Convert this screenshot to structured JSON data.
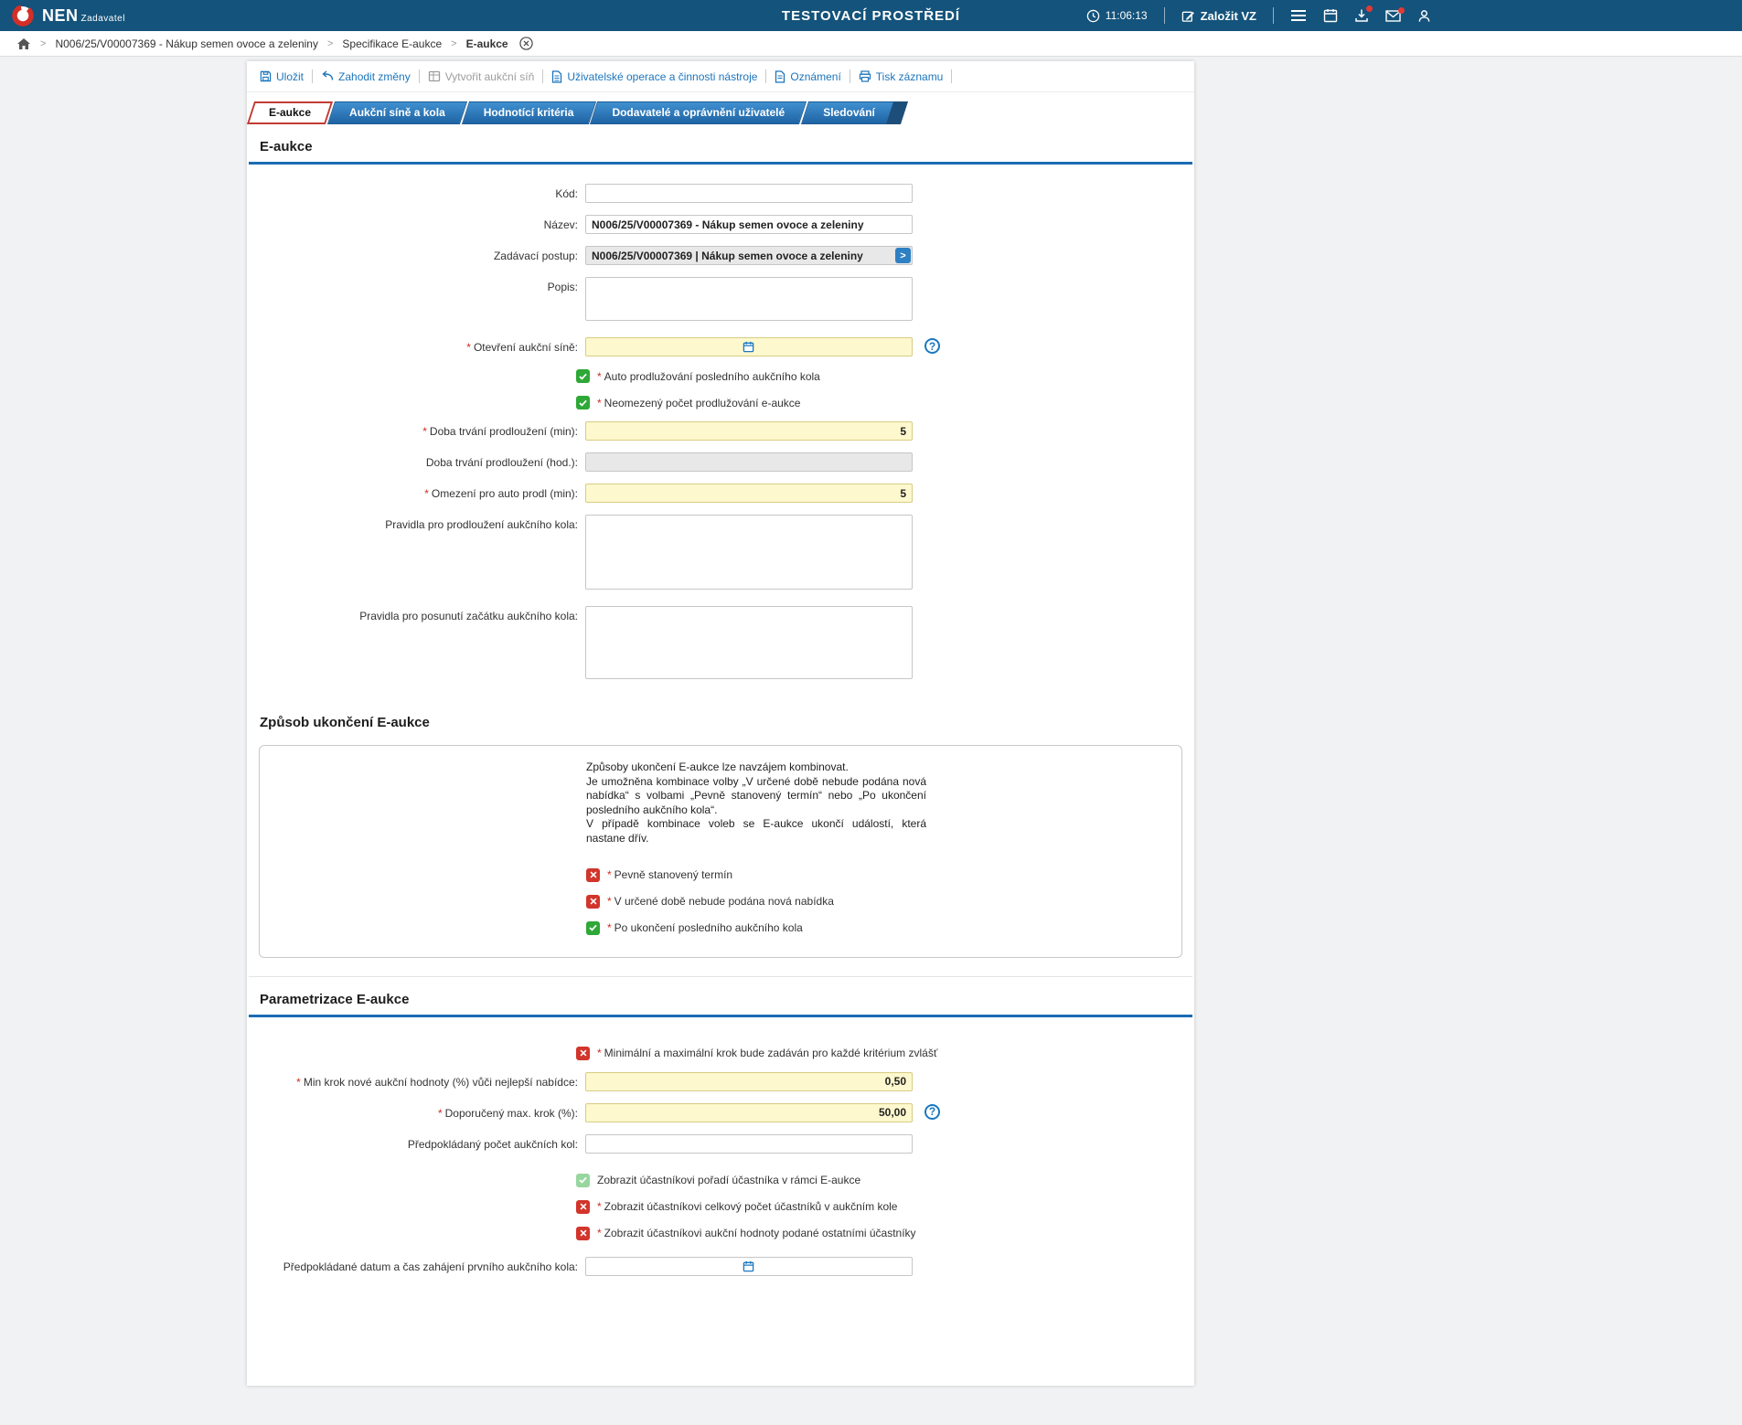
{
  "topbar": {
    "brand": "NEN",
    "brand_sub": "Zadavatel",
    "env_title": "TESTOVACÍ PROSTŘEDÍ",
    "time": "11:06:13",
    "new_vz_label": "Založit VZ"
  },
  "breadcrumb": {
    "separator": ">",
    "items": [
      "N006/25/V00007369 - Nákup semen ovoce a zeleniny",
      "Specifikace E-aukce",
      "E-aukce"
    ]
  },
  "toolbar": {
    "save": "Uložit",
    "discard": "Zahodit změny",
    "create_hall": "Vytvořit aukční síň",
    "user_ops": "Uživatelské operace a činnosti nástroje",
    "notices": "Oznámení",
    "print": "Tisk záznamu"
  },
  "tabs": [
    {
      "label": "E-aukce"
    },
    {
      "label": "Aukční síně a kola"
    },
    {
      "label": "Hodnotící kritéria"
    },
    {
      "label": "Dodavatelé a oprávnění uživatelé"
    },
    {
      "label": "Sledování"
    }
  ],
  "misc": {
    "required_mark": "*",
    "help_mark": "?",
    "chevron": ">"
  },
  "section_eaukce": {
    "title": "E-aukce",
    "kod_label": "Kód:",
    "nazev_label": "Název:",
    "nazev_value": "N006/25/V00007369 - Nákup semen ovoce a zeleniny",
    "zadavaci_label": "Zadávací postup:",
    "zadavaci_value": "N006/25/V00007369 | Nákup semen ovoce a zeleniny",
    "popis_label": "Popis:",
    "otevreni_label": "Otevření aukční síně:",
    "auto_prodluzovani_label": "Auto prodlužování posledního aukčního kola",
    "neomezeny_pocet_label": "Neomezený počet prodlužování e-aukce",
    "doba_min_label": "Doba trvání prodloužení (min):",
    "doba_min_value": "5",
    "doba_hod_label": "Doba trvání prodloužení (hod.):",
    "omezeni_label": "Omezení pro auto prodl (min):",
    "omezeni_value": "5",
    "pravidla_prodlouzeni_label": "Pravidla pro prodloužení aukčního kola:",
    "pravidla_posunuti_label": "Pravidla pro posunutí začátku aukčního kola:"
  },
  "section_ukonceni": {
    "title": "Způsob ukončení E-aukce",
    "info": [
      "Způsoby ukončení E-aukce lze navzájem kombinovat.",
      "Je umožněna kombinace volby „V určené době nebude podána nová nabídka“ s volbami „Pevně stanovený termín“ nebo „Po ukončení posledního aukčního kola“.",
      "V případě kombinace voleb se E-aukce ukončí událostí, která nastane dřív."
    ],
    "pevny_termin_label": "Pevně stanovený termín",
    "urcena_doba_label": "V určené době nebude podána nová nabídka",
    "po_ukonceni_label": "Po ukončení posledního aukčního kola"
  },
  "section_parametrizace": {
    "title": "Parametrizace E-aukce",
    "min_max_krok_label": "Minimální a maximální krok bude zadáván pro každé kritérium zvlášť",
    "min_krok_label": "Min krok nové aukční hodnoty (%) vůči nejlepší nabídce:",
    "min_krok_value": "0,50",
    "max_krok_label": "Doporučený max. krok (%):",
    "max_krok_value": "50,00",
    "pocet_kol_label": "Předpokládaný počet aukčních kol:",
    "poradi_label": "Zobrazit účastníkovi pořadí účastníka v rámci E-aukce",
    "celkovy_pocet_label": "Zobrazit účastníkovi celkový počet účastníků v aukčním kole",
    "hodnoty_ostatni_label": "Zobrazit účastníkovi aukční hodnoty podané ostatními účastníky",
    "datum_zahajeni_label": "Předpokládané datum a čas zahájení prvního aukčního kola:"
  },
  "colors": {
    "topbar": "#14537B",
    "tab_blue": "#2E7CBE",
    "active_tab_border": "#C23B34",
    "link_blue": "#1C75BC",
    "check_green": "#2EA836",
    "check_red": "#D2352B",
    "field_yellow": "#FDF8CD"
  }
}
